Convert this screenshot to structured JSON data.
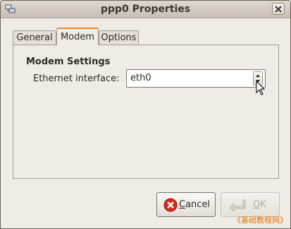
{
  "window": {
    "title": "ppp0 Properties",
    "icon": "network-properties-icon"
  },
  "tabs": [
    {
      "label": "General",
      "active": false
    },
    {
      "label": "Modem",
      "active": true
    },
    {
      "label": "Options",
      "active": false
    }
  ],
  "modem_settings": {
    "heading": "Modem Settings",
    "ethernet_label": "Ethernet interface:",
    "ethernet_value": "eth0"
  },
  "buttons": {
    "cancel": {
      "label": "Cancel",
      "icon": "cancel-icon",
      "enabled": true
    },
    "ok": {
      "label": "OK",
      "icon": "ok-arrow-icon",
      "enabled": false
    }
  },
  "watermark": "《基础教程网》",
  "colors": {
    "active_tab_accent": "#e88d2c",
    "cancel_icon": "#d42a1e",
    "watermark": "#e37500"
  }
}
